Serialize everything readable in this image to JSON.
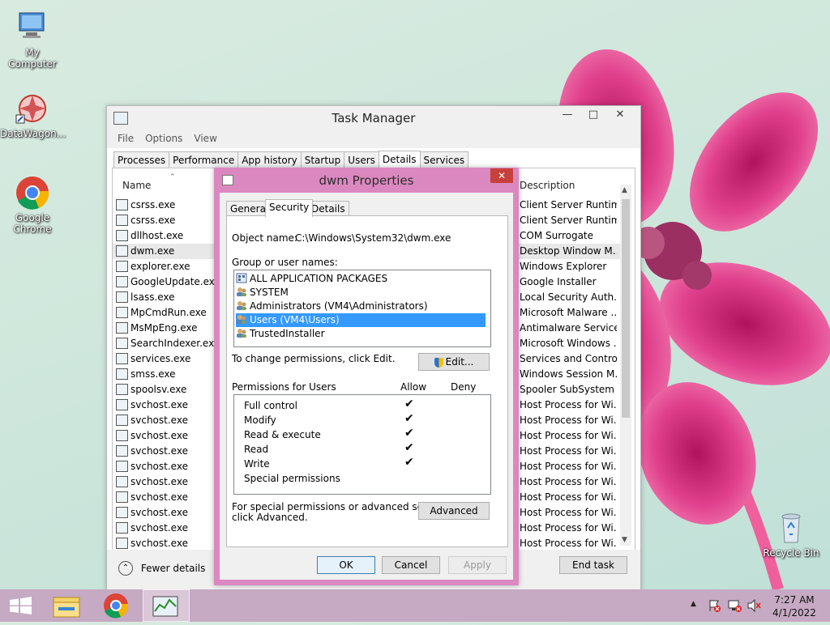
{
  "desktop": {
    "icons": [
      {
        "label": "My Computer"
      },
      {
        "label": "DataWagon..."
      },
      {
        "label": "Google Chrome"
      },
      {
        "label": "Recycle Bin"
      }
    ]
  },
  "task_manager": {
    "title": "Task Manager",
    "menu": [
      "File",
      "Options",
      "View"
    ],
    "tabs": [
      "Processes",
      "Performance",
      "App history",
      "Startup",
      "Users",
      "Details",
      "Services"
    ],
    "active_tab": "Details",
    "columns": {
      "name": "Name",
      "description": "Description"
    },
    "rows": [
      {
        "name": "csrss.exe",
        "description": "Client Server Runtim..."
      },
      {
        "name": "csrss.exe",
        "description": "Client Server Runtim..."
      },
      {
        "name": "dllhost.exe",
        "description": "COM Surrogate"
      },
      {
        "name": "dwm.exe",
        "description": "Desktop Window M..."
      },
      {
        "name": "explorer.exe",
        "description": "Windows Explorer"
      },
      {
        "name": "GoogleUpdate.exe",
        "description": "Google Installer"
      },
      {
        "name": "lsass.exe",
        "description": "Local Security Auth..."
      },
      {
        "name": "MpCmdRun.exe",
        "description": "Microsoft Malware ..."
      },
      {
        "name": "MsMpEng.exe",
        "description": "Antimalware Service..."
      },
      {
        "name": "SearchIndexer.exe",
        "description": "Microsoft Windows ..."
      },
      {
        "name": "services.exe",
        "description": "Services and Control..."
      },
      {
        "name": "smss.exe",
        "description": "Windows Session M..."
      },
      {
        "name": "spoolsv.exe",
        "description": "Spooler SubSystem ..."
      },
      {
        "name": "svchost.exe",
        "description": "Host Process for Wi..."
      },
      {
        "name": "svchost.exe",
        "description": "Host Process for Wi..."
      },
      {
        "name": "svchost.exe",
        "description": "Host Process for Wi..."
      },
      {
        "name": "svchost.exe",
        "description": "Host Process for Wi..."
      },
      {
        "name": "svchost.exe",
        "description": "Host Process for Wi..."
      },
      {
        "name": "svchost.exe",
        "description": "Host Process for Wi..."
      },
      {
        "name": "svchost.exe",
        "description": "Host Process for Wi..."
      },
      {
        "name": "svchost.exe",
        "description": "Host Process for Wi..."
      },
      {
        "name": "svchost.exe",
        "description": "Host Process for Wi..."
      },
      {
        "name": "svchost.exe",
        "description": "Host Process for Wi..."
      }
    ],
    "fewer_details": "Fewer details",
    "end_task": "End task"
  },
  "dialog": {
    "title": "dwm Properties",
    "tabs": [
      "General",
      "Security",
      "Details"
    ],
    "active_tab": "Security",
    "object_name_label": "Object name:",
    "object_name_value": "C:\\Windows\\System32\\dwm.exe",
    "groups_label": "Group or user names:",
    "groups": [
      {
        "name": "ALL APPLICATION PACKAGES"
      },
      {
        "name": "SYSTEM"
      },
      {
        "name": "Administrators (VM4\\Administrators)"
      },
      {
        "name": "Users (VM4\\Users)",
        "selected": true
      },
      {
        "name": "TrustedInstaller"
      }
    ],
    "change_text": "To change permissions, click Edit.",
    "edit_button": "Edit...",
    "permissions_label": "Permissions for Users",
    "allow_label": "Allow",
    "deny_label": "Deny",
    "permissions": [
      {
        "name": "Full control",
        "allow": true,
        "deny": false
      },
      {
        "name": "Modify",
        "allow": true,
        "deny": false
      },
      {
        "name": "Read & execute",
        "allow": true,
        "deny": false
      },
      {
        "name": "Read",
        "allow": true,
        "deny": false
      },
      {
        "name": "Write",
        "allow": true,
        "deny": false
      },
      {
        "name": "Special permissions",
        "allow": false,
        "deny": false
      }
    ],
    "advanced_text_1": "For special permissions or advanced settings,",
    "advanced_text_2": "click Advanced.",
    "advanced_button": "Advanced",
    "ok_button": "OK",
    "cancel_button": "Cancel",
    "apply_button": "Apply"
  },
  "taskbar": {
    "time": "7:27 AM",
    "date": "4/1/2022"
  },
  "colors": {
    "selection": "#3399ff",
    "dialog_frame": "#db88c0",
    "taskbar": "#c6a9c3",
    "close_button": "#c6413c"
  }
}
